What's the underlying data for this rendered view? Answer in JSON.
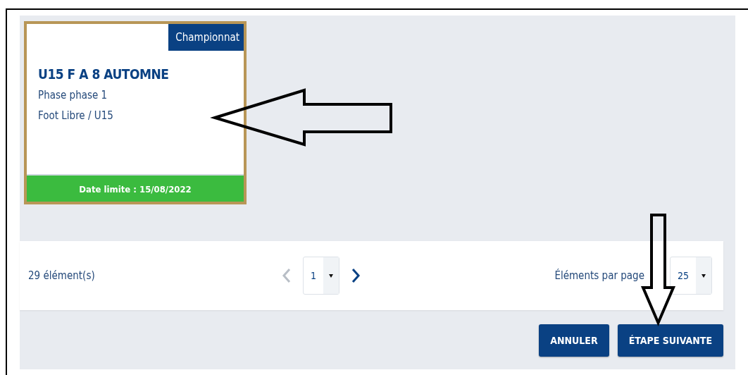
{
  "card": {
    "tag": "Championnat",
    "title": "U15 F A 8 AUTOMNE",
    "lines": [
      "Phase phase 1",
      "Foot Libre / U15"
    ],
    "deadline": "Date limite : 15/08/2022",
    "selected": true
  },
  "pagination": {
    "count": "29 élément(s)",
    "prev": {
      "disabled": true
    },
    "page": "1",
    "next": {
      "disabled": false
    },
    "per_page_label": "Éléments par page",
    "per_page": "25"
  },
  "buttons": [
    {
      "label": "ANNULER"
    },
    {
      "label": "ÉTAPE SUIVANTE"
    }
  ]
}
